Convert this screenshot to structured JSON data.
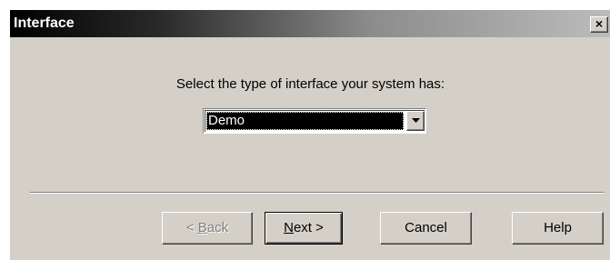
{
  "window": {
    "title": "Interface",
    "close_glyph": "×",
    "close_icon": "close-icon"
  },
  "main": {
    "prompt": "Select the type of interface your system has:",
    "interface_select": {
      "selected": "Demo",
      "arrow_icon": "chevron-down-icon"
    }
  },
  "buttons": {
    "back": {
      "arrow": "< ",
      "mnemonic": "B",
      "rest": "ack",
      "enabled": false
    },
    "next": {
      "mnemonic": "N",
      "rest": "ext >",
      "enabled": true,
      "default": true
    },
    "cancel": {
      "label": "Cancel"
    },
    "help": {
      "label": "Help"
    }
  },
  "colors": {
    "dialog_face": "#d4d0c8",
    "selection": "#000000",
    "disabled_text": "#808080"
  }
}
